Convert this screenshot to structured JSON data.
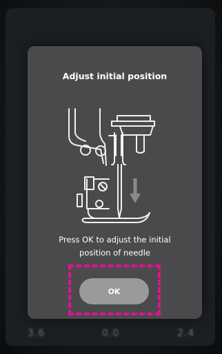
{
  "dialog": {
    "title": "Adjust initial position",
    "message_line1": "Press OK to adjust the initial",
    "message_line2": "position of needle",
    "ok_label": "OK",
    "illustration_icon": "needle-down-arrow-icon",
    "highlight_color": "#e6108e"
  },
  "background": {
    "value_left": "3.6",
    "value_mid": "0.0",
    "value_right": "2.4"
  }
}
